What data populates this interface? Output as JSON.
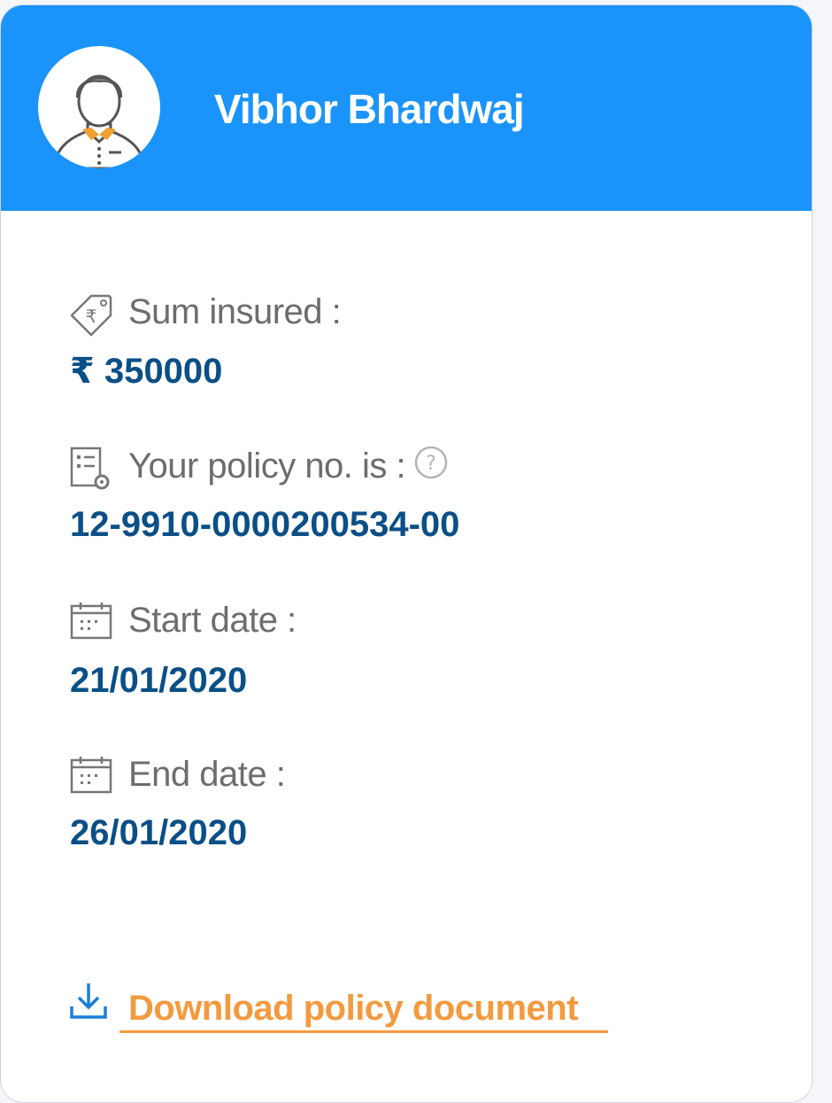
{
  "user": {
    "name": "Vibhor Bhardwaj"
  },
  "fields": {
    "sum_insured": {
      "label": "Sum insured :",
      "value": "₹ 350000",
      "icon": "price-tag-rupee-icon"
    },
    "policy_no": {
      "label": "Your policy no. is :",
      "value": "12-9910-0000200534-00",
      "icon": "policy-document-icon",
      "help_icon": "question-mark-icon"
    },
    "start_date": {
      "label": "Start date :",
      "value": "21/01/2020",
      "icon": "calendar-icon"
    },
    "end_date": {
      "label": "End date :",
      "value": "26/01/2020",
      "icon": "calendar-icon"
    }
  },
  "download": {
    "label": "Download policy document",
    "icon": "download-icon"
  },
  "colors": {
    "header": "#1a94fb",
    "value_text": "#0b4f86",
    "label_text": "#6d6d6d",
    "accent_orange": "#f39a3e"
  }
}
